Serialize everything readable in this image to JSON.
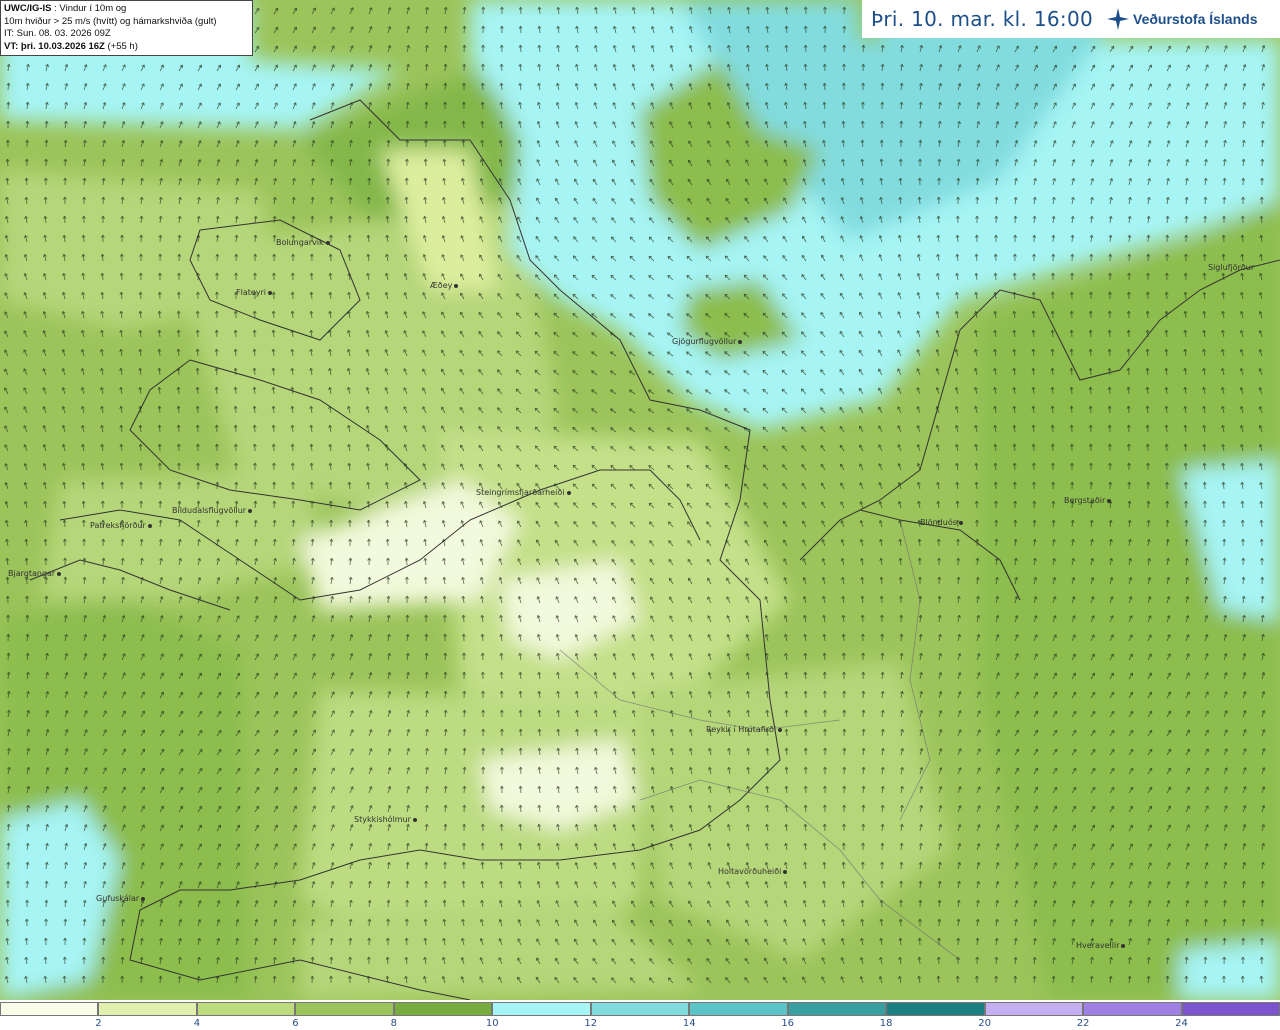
{
  "header": {
    "model_name": "UWC/IG-IS",
    "line1_rest": " : Vindur í 10m og",
    "line2": "10m hviður > 25 m/s (hvítt) og hámarkshviða (gult)",
    "line3": "IT: Sun. 08. 03. 2026 09Z",
    "line4_bold": "VT: þri. 10.03.2026 16Z",
    "line4_rest": " (+55 h)"
  },
  "time_banner": {
    "text": "Þri. 10. mar. kl. 16:00",
    "logo_text": "Veðurstofa Íslands",
    "logo_icon": "compass-star-icon"
  },
  "places": [
    {
      "name": "Bolungarvík"
    },
    {
      "name": "Flateyri"
    },
    {
      "name": "Æðey"
    },
    {
      "name": "Gjögurflugvöllur"
    },
    {
      "name": "Siglufjörður"
    },
    {
      "name": "Steingrímsfjarðarheiði"
    },
    {
      "name": "Bíldudalsflugvöllur"
    },
    {
      "name": "Patreksfjörður"
    },
    {
      "name": "Bjargtangar"
    },
    {
      "name": "Blönduós"
    },
    {
      "name": "Bergstaðir"
    },
    {
      "name": "Reykir í Hrútafirði"
    },
    {
      "name": "Stykkishólmur"
    },
    {
      "name": "Holtavörðuheiði"
    },
    {
      "name": "Gufuskálar"
    },
    {
      "name": "Hveravellir"
    }
  ],
  "legend": {
    "bins": [
      {
        "color": "#fafde9"
      },
      {
        "color": "#e1f0ae"
      },
      {
        "color": "#bedc7d"
      },
      {
        "color": "#9bc45a"
      },
      {
        "color": "#78ac3e"
      },
      {
        "color": "#a6f4f4"
      },
      {
        "color": "#82dcde"
      },
      {
        "color": "#5cc3c6"
      },
      {
        "color": "#399fa1"
      },
      {
        "color": "#1e7f82"
      },
      {
        "color": "#c4b0f0"
      },
      {
        "color": "#9e7fe2"
      },
      {
        "color": "#7a55cc"
      },
      {
        "color": "#5435b0"
      },
      {
        "color": "#3d1c8e"
      },
      {
        "color": "#f4a7a7"
      }
    ],
    "ticks": [
      "2",
      "4",
      "6",
      "8",
      "10",
      "12",
      "14",
      "16",
      "18",
      "20",
      "22",
      "24"
    ]
  }
}
